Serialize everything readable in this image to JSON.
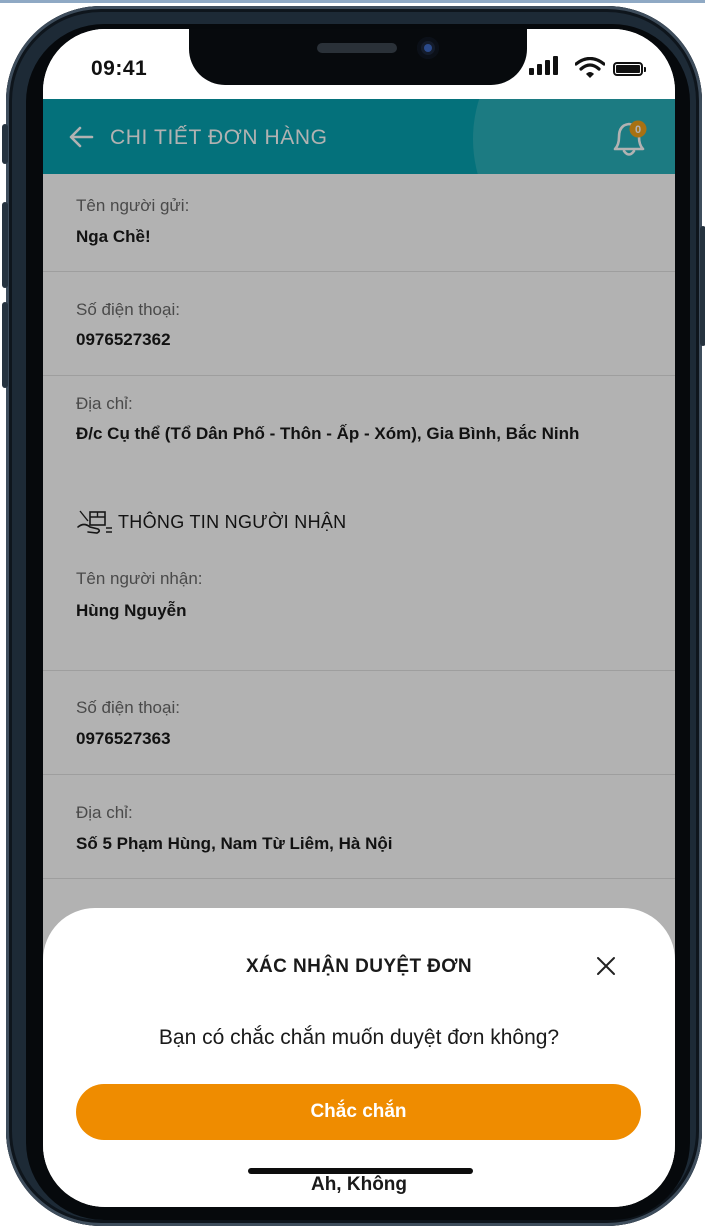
{
  "status_bar": {
    "time": "09:41"
  },
  "header": {
    "title": "CHI TIẾT ĐƠN HÀNG",
    "notification_count": "0",
    "back_icon": "arrow-left-icon",
    "bell_icon": "bell-icon",
    "color": "#06a3b0"
  },
  "sender": {
    "name_label": "Tên người gửi:",
    "name": "Nga Chề!",
    "phone_label": "Số điện thoại:",
    "phone": "0976527362",
    "address_label": "Địa chỉ:",
    "address": "Đ/c Cụ thể (Tổ Dân Phố - Thôn - Ấp - Xóm), Gia Bình, Bắc Ninh"
  },
  "receiver": {
    "section_title": "THÔNG TIN NGƯỜI NHẬN",
    "section_icon": "package-hand-icon",
    "name_label": "Tên người nhận:",
    "name": "Hùng Nguyễn",
    "phone_label": "Số điện thoại:",
    "phone": "0976527363",
    "address_label": "Địa chỉ:",
    "address": "Số 5 Phạm Hùng, Nam Từ Liêm, Hà Nội"
  },
  "modal": {
    "title": "XÁC NHẬN DUYỆT ĐƠN",
    "message": "Bạn có chắc chắn muốn duyệt đơn không?",
    "confirm_label": "Chắc chắn",
    "cancel_label": "Ah, Không",
    "close_icon": "close-icon",
    "confirm_color": "#ef8c00"
  }
}
